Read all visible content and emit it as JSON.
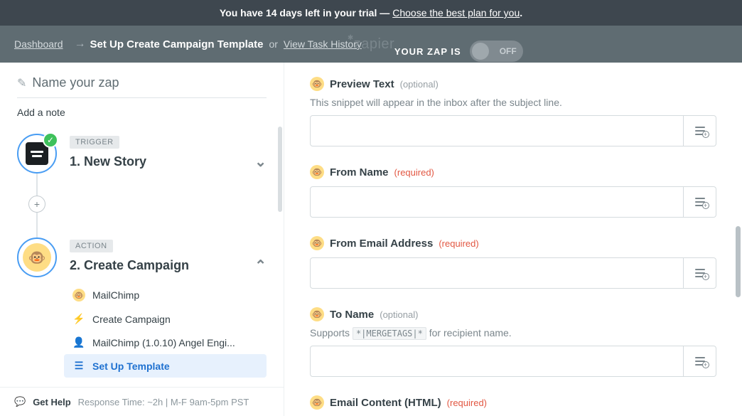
{
  "trial": {
    "prefix": "You have 14 days left in your trial —",
    "link": "Choose the best plan for you",
    "dot": "."
  },
  "header": {
    "dashboard": "Dashboard",
    "arrow": "→",
    "title": "Set Up Create Campaign Template",
    "or": "or",
    "taskHistory": "View Task History",
    "logoText": "zapier",
    "zapLabel": "YOUR ZAP IS",
    "toggleOff": "OFF"
  },
  "left": {
    "namePlaceholder": "Name your zap",
    "addNote": "Add a note",
    "trigger": {
      "tag": "TRIGGER",
      "title": "1. New Story"
    },
    "action": {
      "tag": "ACTION",
      "title": "2. Create Campaign",
      "sub": {
        "app": "MailChimp",
        "event": "Create Campaign",
        "account": "MailChimp (1.0.10) Angel Engi...",
        "setup": "Set Up Template"
      }
    },
    "help": {
      "label": "Get Help",
      "meta": "Response Time: ~2h | M-F 9am-5pm PST"
    }
  },
  "fields": {
    "preview": {
      "label": "Preview Text",
      "badge": "(optional)",
      "desc": "This snippet will appear in the inbox after the subject line."
    },
    "fromName": {
      "label": "From Name",
      "badge": "(required)"
    },
    "fromEmail": {
      "label": "From Email Address",
      "badge": "(required)"
    },
    "toName": {
      "label": "To Name",
      "badge": "(optional)",
      "descPre": "Supports ",
      "code": "*|MERGETAGS|*",
      "descPost": " for recipient name."
    },
    "emailContent": {
      "label": "Email Content (HTML)",
      "badge": "(required)"
    }
  }
}
